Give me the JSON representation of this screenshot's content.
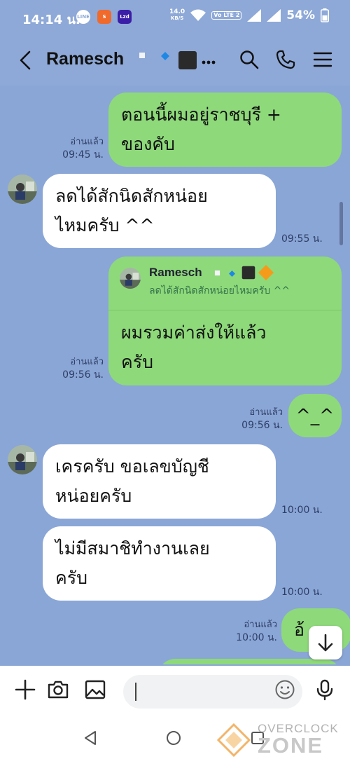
{
  "status_bar": {
    "time": "14:14 น.",
    "app_icons": [
      "LINE",
      "S",
      "Lzd"
    ],
    "net_speed_value": "14.0",
    "net_speed_unit": "KB/S",
    "network_label": "Vo LTE 2",
    "battery": "54%"
  },
  "header": {
    "title": "Ramesch"
  },
  "messages": [
    {
      "direction": "out",
      "lines": [
        "ตอนนี้ผมอยู่ราชบุรี +",
        "ของคับ"
      ],
      "read": "อ่านแล้ว",
      "time": "09:45 น."
    },
    {
      "direction": "in",
      "lines": [
        "ลดได้สักนิดสักหน่อย",
        "ไหมครับ ^^"
      ],
      "time": "09:55 น."
    },
    {
      "direction": "out",
      "reply_to_name": "Ramesch",
      "reply_to_text": "ลดได้สักนิดสักหน่อยไหมครับ ^^",
      "lines": [
        "ผมรวมค่าส่งให้แล้ว",
        "ครับ"
      ],
      "read": "อ่านแล้ว",
      "time": "09:56 น."
    },
    {
      "direction": "out",
      "lines": [
        "^_^"
      ],
      "read": "อ่านแล้ว",
      "time": "09:56 น."
    },
    {
      "direction": "in",
      "lines": [
        "เครครับ ขอเลขบัญชี",
        "หน่อยครับ"
      ],
      "time": "10:00 น."
    },
    {
      "direction": "in",
      "lines": [
        "ไม่มีสมาชิทำงานเลย",
        "ครับ"
      ],
      "time": "10:00 น."
    },
    {
      "direction": "out",
      "lines": [
        "อ้"
      ],
      "read": "อ่านแล้ว",
      "time": "10:00 น."
    }
  ],
  "input": {
    "value": ""
  },
  "icons": {
    "back": "chevron-left-icon",
    "search": "search-icon",
    "call": "phone-icon",
    "menu": "menu-icon",
    "add": "plus-icon",
    "camera": "camera-icon",
    "image": "image-icon",
    "emoji": "emoji-icon",
    "mic": "microphone-icon"
  },
  "watermark": {
    "line1": "OVERCLOCK",
    "line2": "ZONE"
  },
  "colors": {
    "chat_background": "#8aa6d6",
    "outgoing_bubble": "#8ed97a",
    "incoming_bubble": "#ffffff"
  }
}
